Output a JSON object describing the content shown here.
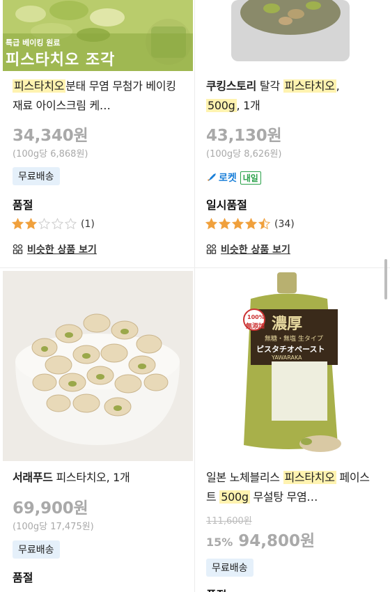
{
  "products": [
    {
      "banner_small": "특급 베이킹 원료",
      "banner_large": "피스타치오 조각",
      "title_hl": "피스타치오",
      "title_rest": "분태 무염 무첨가 베이킹 재료 아이스크림 케…",
      "price": "34,340원",
      "unit_price": "(100g당 6,868원)",
      "shipping": "무료배송",
      "status": "품절",
      "rating": 2,
      "review_count": "(1)",
      "similar": "비슷한 상품 보기"
    },
    {
      "brand": "쿠킹스토리",
      "title_mid": " 탈각 ",
      "title_hl": "피스타치오",
      "title_sep": ",",
      "title_hl2": "500g",
      "title_end": ", 1개",
      "price": "43,130원",
      "unit_price": "(100g당 8,626원)",
      "rocket": "로켓",
      "rocket_day": "내일",
      "status": "일시품절",
      "rating": 4.5,
      "review_count": "(34)",
      "similar": "비슷한 상품 보기"
    },
    {
      "brand": "서래푸드",
      "title_rest": " 피스타치오, 1개",
      "price": "69,900원",
      "unit_price": "(100g당 17,475원)",
      "shipping": "무료배송",
      "status": "품절"
    },
    {
      "title_pre": "일본 노체블리스 ",
      "title_hl": "피스타치오",
      "title_mid": " 페이스트 ",
      "title_hl2": "500g",
      "title_end": " 무설탕 무염…",
      "original_price": "111,600원",
      "discount": "15%",
      "price": "94,800원",
      "shipping": "무료배송",
      "status": "품절",
      "package": {
        "badge_top": "100%",
        "badge_bottom": "無添加",
        "header": "濃厚",
        "sub": "無糖・無塩 生タイプ",
        "name": "ピスタチオペースト",
        "brand": "YAWARAKA"
      }
    }
  ],
  "colors": {
    "highlight": "#fff3b0",
    "price_gray": "#a9a9a9",
    "star": "#f0a03c",
    "ship_bg": "#e5f0fa"
  }
}
